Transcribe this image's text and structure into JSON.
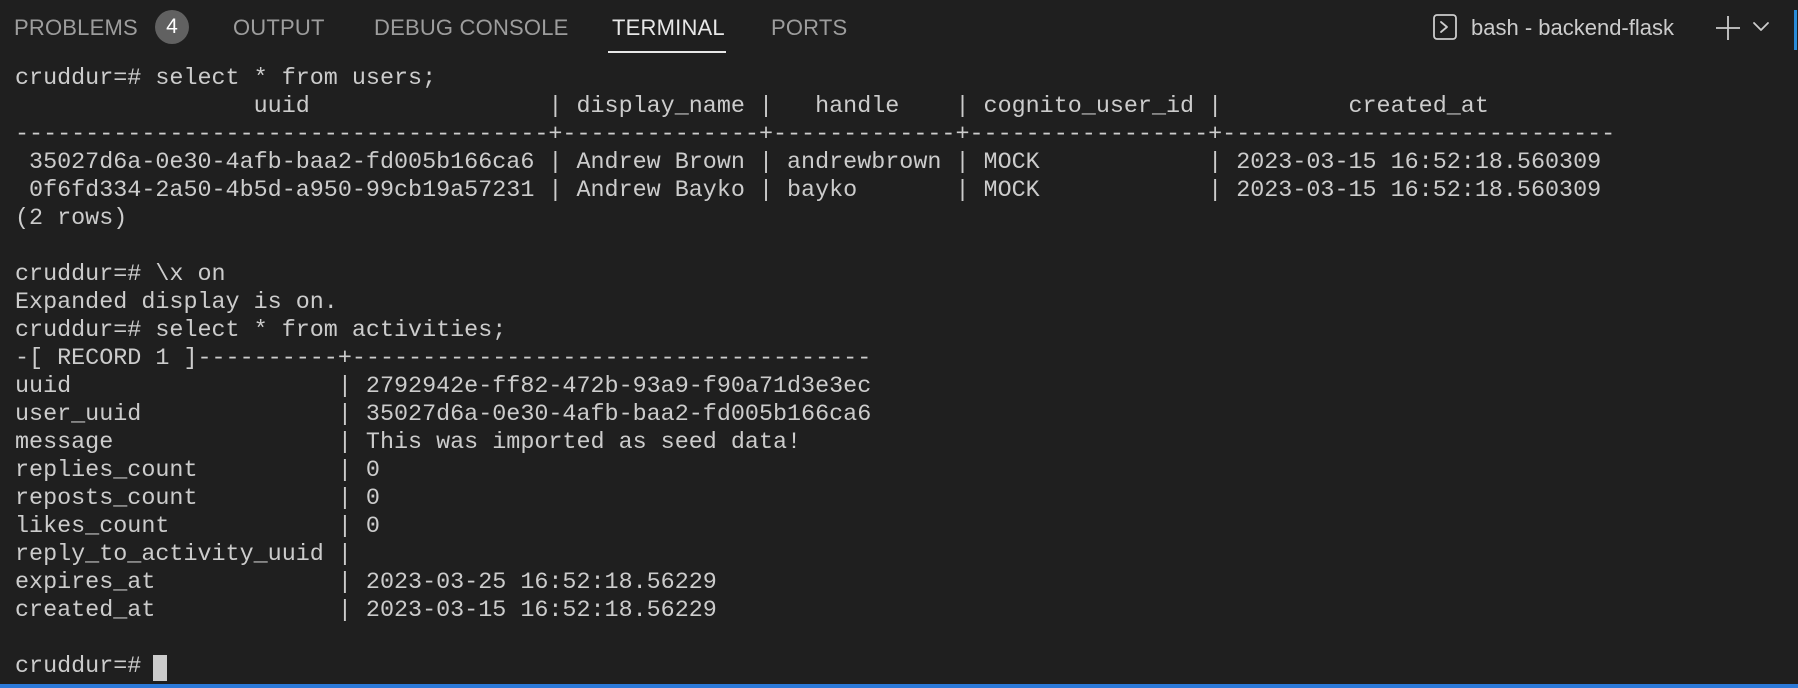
{
  "panel": {
    "tabs": [
      {
        "label": "PROBLEMS",
        "badge": "4",
        "active": false
      },
      {
        "label": "OUTPUT",
        "active": false
      },
      {
        "label": "DEBUG CONSOLE",
        "active": false
      },
      {
        "label": "TERMINAL",
        "active": true
      },
      {
        "label": "PORTS",
        "active": false
      }
    ],
    "terminal_title": "bash - backend-flask",
    "icons": {
      "terminal": "terminal-icon",
      "new_terminal": "plus-icon",
      "dropdown": "chevron-down-icon"
    },
    "colors": {
      "background": "#1f1f1f",
      "text": "#cccccc",
      "active_tab": "#e7e7e7",
      "inactive_tab": "#9d9d9d",
      "badge": "#616161",
      "accent": "#2b79d8"
    }
  },
  "terminal": {
    "lines": [
      "cruddur=# select * from users;",
      "                 uuid                 | display_name |   handle    | cognito_user_id |         created_at",
      "--------------------------------------+--------------+-------------+-----------------+----------------------------",
      " 35027d6a-0e30-4afb-baa2-fd005b166ca6 | Andrew Brown | andrewbrown | MOCK            | 2023-03-15 16:52:18.560309",
      " 0f6fd334-2a50-4b5d-a950-99cb19a57231 | Andrew Bayko | bayko       | MOCK            | 2023-03-15 16:52:18.560309",
      "(2 rows)",
      "",
      "cruddur=# \\x on",
      "Expanded display is on.",
      "cruddur=# select * from activities;",
      "-[ RECORD 1 ]----------+-------------------------------------",
      "uuid                   | 2792942e-ff82-472b-93a9-f90a71d3e3ec",
      "user_uuid              | 35027d6a-0e30-4afb-baa2-fd005b166ca6",
      "message                | This was imported as seed data!",
      "replies_count          | 0",
      "reposts_count          | 0",
      "likes_count            | 0",
      "reply_to_activity_uuid |",
      "expires_at             | 2023-03-25 16:52:18.56229",
      "created_at             | 2023-03-15 16:52:18.56229",
      "",
      "cruddur=# "
    ]
  }
}
